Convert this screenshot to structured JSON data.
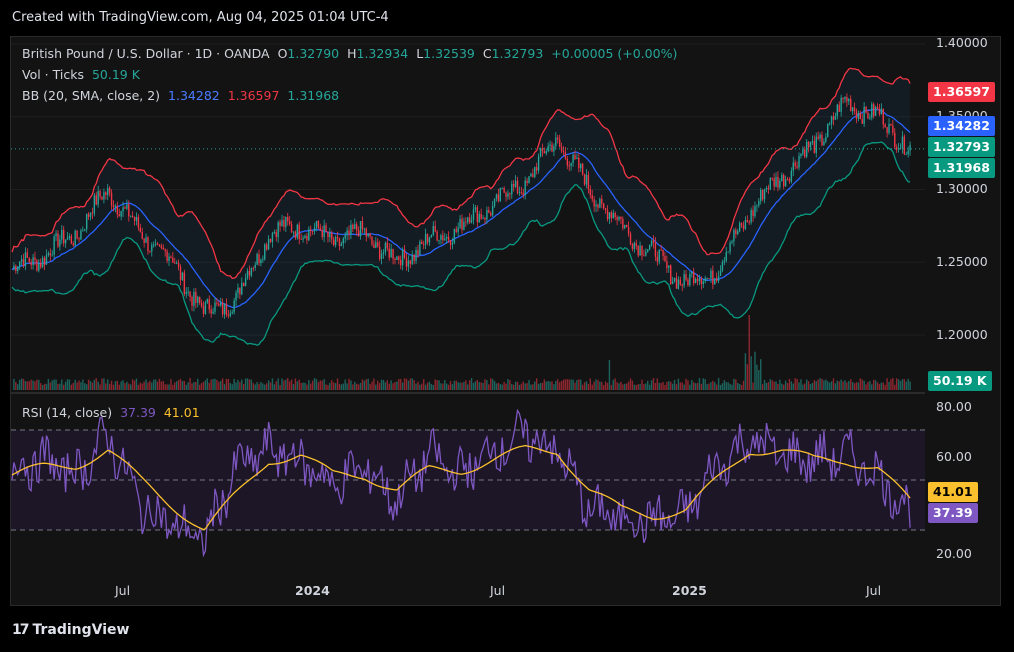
{
  "header": {
    "created": "Created with TradingView.com, Aug 04, 2025 01:04 UTC-4"
  },
  "legend": {
    "symbol": "British Pound / U.S. Dollar · 1D · OANDA",
    "o_label": "O",
    "o": "1.32790",
    "h_label": "H",
    "h": "1.32934",
    "l_label": "L",
    "l": "1.32539",
    "c_label": "C",
    "c": "1.32793",
    "change": "+0.00005 (+0.00%)",
    "vol_label": "Vol · Ticks",
    "vol": "50.19 K",
    "bb_label": "BB (20, SMA, close, 2)",
    "bb_basis": "1.34282",
    "bb_upper": "1.36597",
    "bb_lower": "1.31968",
    "rsi_label": "RSI (14, close)",
    "rsi": "37.39",
    "rsi_ma": "41.01"
  },
  "price_axis": [
    "1.40000",
    "1.35000",
    "1.30000",
    "1.25000",
    "1.20000"
  ],
  "price_tags": {
    "upper": "1.36597",
    "basis": "1.34282",
    "last": "1.32793",
    "lower": "1.31968",
    "volume": "50.19 K"
  },
  "rsi_axis": [
    "80.00",
    "60.00",
    "20.00"
  ],
  "rsi_tags": {
    "ma": "41.01",
    "rsi": "37.39"
  },
  "time_axis": [
    "Jul",
    "2024",
    "Jul",
    "2025",
    "Jul"
  ],
  "footer": {
    "logo": "17",
    "brand": "TradingView"
  },
  "colors": {
    "up": "#26a69a",
    "down": "#f23645",
    "basis": "#2962ff",
    "upper": "#f23645",
    "lower": "#089981",
    "rsi": "#7e57c2",
    "rsi_ma": "#fbc02d"
  },
  "chart_data": [
    {
      "type": "candlestick",
      "title": "British Pound / U.S. Dollar · 1D · OANDA",
      "x": [
        "2023-04",
        "2023-05",
        "2023-06",
        "2023-07",
        "2023-08",
        "2023-09",
        "2023-10",
        "2023-11",
        "2023-12",
        "2024-01",
        "2024-02",
        "2024-03",
        "2024-04",
        "2024-05",
        "2024-06",
        "2024-07",
        "2024-08",
        "2024-09",
        "2024-10",
        "2024-11",
        "2024-12",
        "2025-01",
        "2025-02",
        "2025-03",
        "2025-04",
        "2025-05",
        "2025-06",
        "2025-07",
        "2025-08"
      ],
      "close": [
        1.245,
        1.255,
        1.27,
        1.3,
        1.27,
        1.25,
        1.215,
        1.225,
        1.27,
        1.275,
        1.265,
        1.27,
        1.25,
        1.265,
        1.275,
        1.29,
        1.305,
        1.335,
        1.3,
        1.275,
        1.255,
        1.235,
        1.245,
        1.285,
        1.31,
        1.33,
        1.36,
        1.35,
        1.328
      ],
      "ylim": [
        1.17,
        1.41
      ],
      "series": [
        {
          "name": "BB (20, SMA, close, 2)",
          "upper_last": 1.36597,
          "basis_last": 1.34282,
          "lower_last": 1.31968
        }
      ]
    },
    {
      "type": "bar",
      "title": "Vol · Ticks",
      "last": 50190
    },
    {
      "type": "line",
      "title": "RSI (14, close)",
      "x": [
        "2023-04",
        "2023-05",
        "2023-06",
        "2023-07",
        "2023-08",
        "2023-09",
        "2023-10",
        "2023-11",
        "2023-12",
        "2024-01",
        "2024-02",
        "2024-03",
        "2024-04",
        "2024-05",
        "2024-06",
        "2024-07",
        "2024-08",
        "2024-09",
        "2024-10",
        "2024-11",
        "2024-12",
        "2025-01",
        "2025-02",
        "2025-03",
        "2025-04",
        "2025-05",
        "2025-06",
        "2025-07",
        "2025-08"
      ],
      "series": [
        {
          "name": "RSI",
          "values": [
            55,
            58,
            52,
            68,
            40,
            32,
            26,
            55,
            62,
            58,
            48,
            55,
            42,
            60,
            52,
            62,
            68,
            62,
            38,
            35,
            34,
            36,
            56,
            66,
            60,
            58,
            60,
            52,
            37.39
          ]
        },
        {
          "name": "MA",
          "values": [
            52,
            55,
            56,
            62,
            50,
            40,
            30,
            44,
            58,
            60,
            52,
            52,
            46,
            54,
            54,
            58,
            62,
            62,
            46,
            38,
            36,
            38,
            50,
            62,
            62,
            58,
            58,
            55,
            41.01
          ]
        }
      ],
      "ylim": [
        12,
        88
      ],
      "bands": [
        30,
        50,
        70
      ]
    }
  ]
}
